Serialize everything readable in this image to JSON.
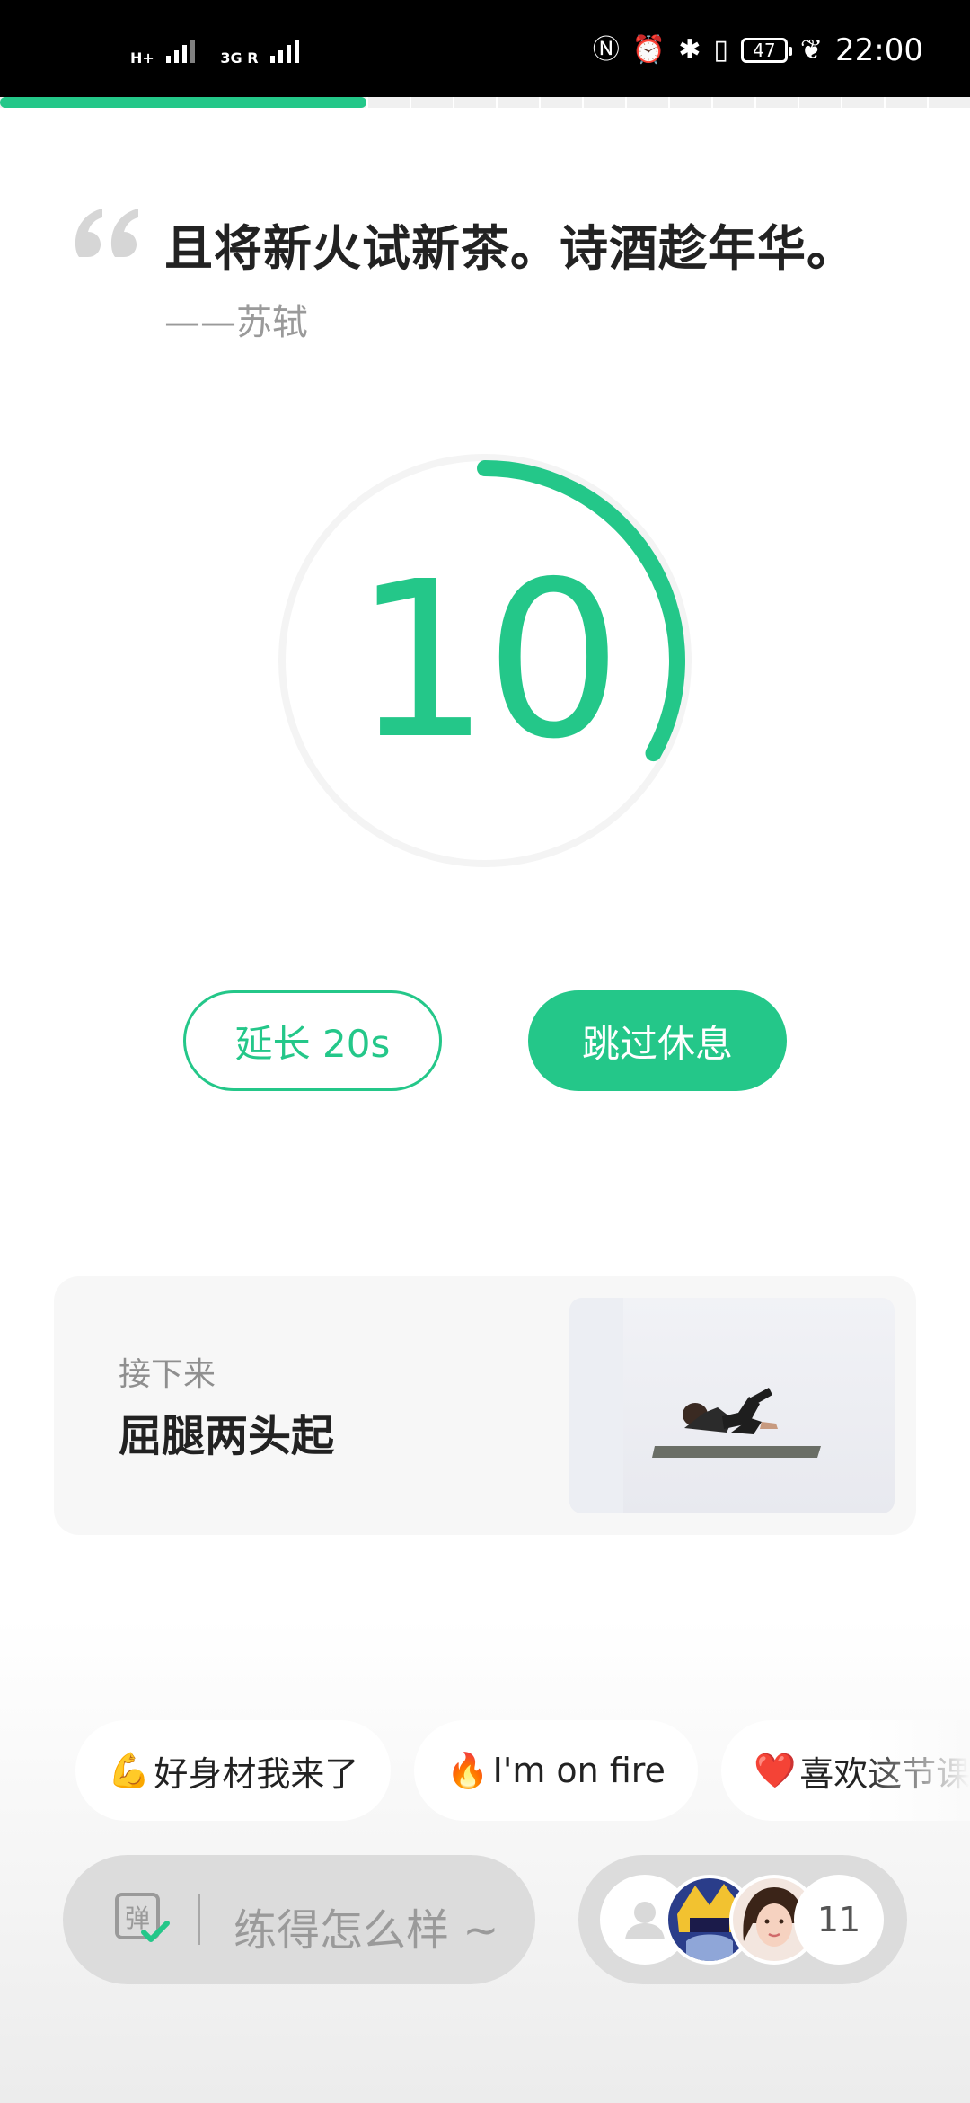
{
  "status_bar": {
    "signal1_label": "H+",
    "signal2_label": "3G R",
    "battery_level": "47",
    "time": "22:00",
    "icons": [
      "nfc-icon",
      "alarm-icon",
      "bluetooth-icon",
      "vibrate-icon",
      "battery-icon",
      "leaf-icon"
    ]
  },
  "workout_progress": {
    "fraction": 0.378,
    "accent": "#24c789"
  },
  "quote": {
    "text": "且将新火试新茶。诗酒趁年华。",
    "author": "——苏轼"
  },
  "rest_timer": {
    "seconds": "10",
    "ring_fraction": 0.33
  },
  "actions": {
    "extend_label": "延长 20s",
    "skip_label": "跳过休息"
  },
  "next_exercise": {
    "label": "接下来",
    "title": "屈腿两头起"
  },
  "reaction_chips": [
    {
      "emoji": "💪",
      "label": "好身材我来了"
    },
    {
      "emoji": "🔥",
      "label": "I'm on fire"
    },
    {
      "emoji": "❤️",
      "label": "喜欢这节课"
    }
  ],
  "comment": {
    "placeholder": "练得怎么样 ~"
  },
  "participants": {
    "count": "11"
  },
  "colors": {
    "accent": "#24c789",
    "text_primary": "#222222",
    "text_secondary": "#9a9a9a"
  }
}
